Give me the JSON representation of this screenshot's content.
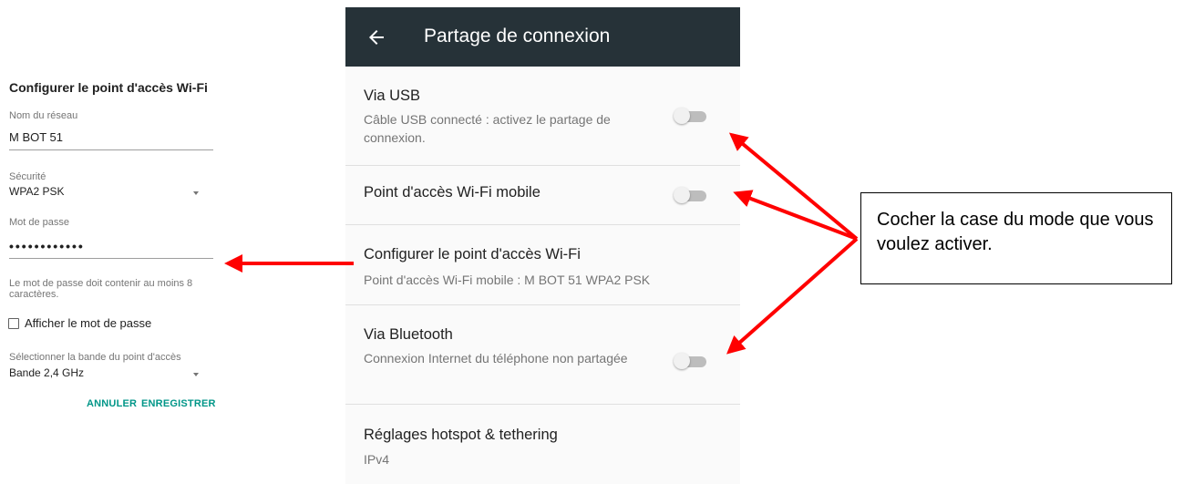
{
  "dialog": {
    "title": "Configurer le point d'accès Wi-Fi",
    "network_label": "Nom du réseau",
    "network_value": "M BOT 51",
    "security_label": "Sécurité",
    "security_value": "WPA2 PSK",
    "password_label": "Mot de passe",
    "password_value": "••••••••••••",
    "password_hint": "Le mot de passe doit contenir au moins 8 caractères.",
    "show_password_label": "Afficher le mot de passe",
    "show_password_checked": false,
    "band_label": "Sélectionner la bande du point d'accès",
    "band_value": "Bande 2,4 GHz",
    "cancel_label": "ANNULER",
    "save_label": "ENREGISTRER"
  },
  "screen": {
    "title": "Partage de connexion",
    "back_icon": "arrow-left-icon",
    "rows": [
      {
        "title": "Via USB",
        "subtitle": "Câble USB connecté : activez le partage de connexion.",
        "toggle": false
      },
      {
        "title": "Point d'accès Wi-Fi mobile",
        "subtitle": "",
        "toggle": false
      },
      {
        "title": "Configurer le point d'accès Wi-Fi",
        "subtitle": "Point d'accès Wi-Fi mobile : M BOT 51 WPA2 PSK"
      },
      {
        "title": "Via Bluetooth",
        "subtitle": "Connexion Internet du téléphone non partagée",
        "toggle": false
      },
      {
        "title": "Réglages hotspot & tethering",
        "subtitle": "IPv4"
      }
    ]
  },
  "callout": {
    "text": "Cocher la case du mode que vous voulez activer."
  },
  "colors": {
    "appbar": "#263238",
    "accent": "#009688",
    "arrow": "#ff0000"
  }
}
